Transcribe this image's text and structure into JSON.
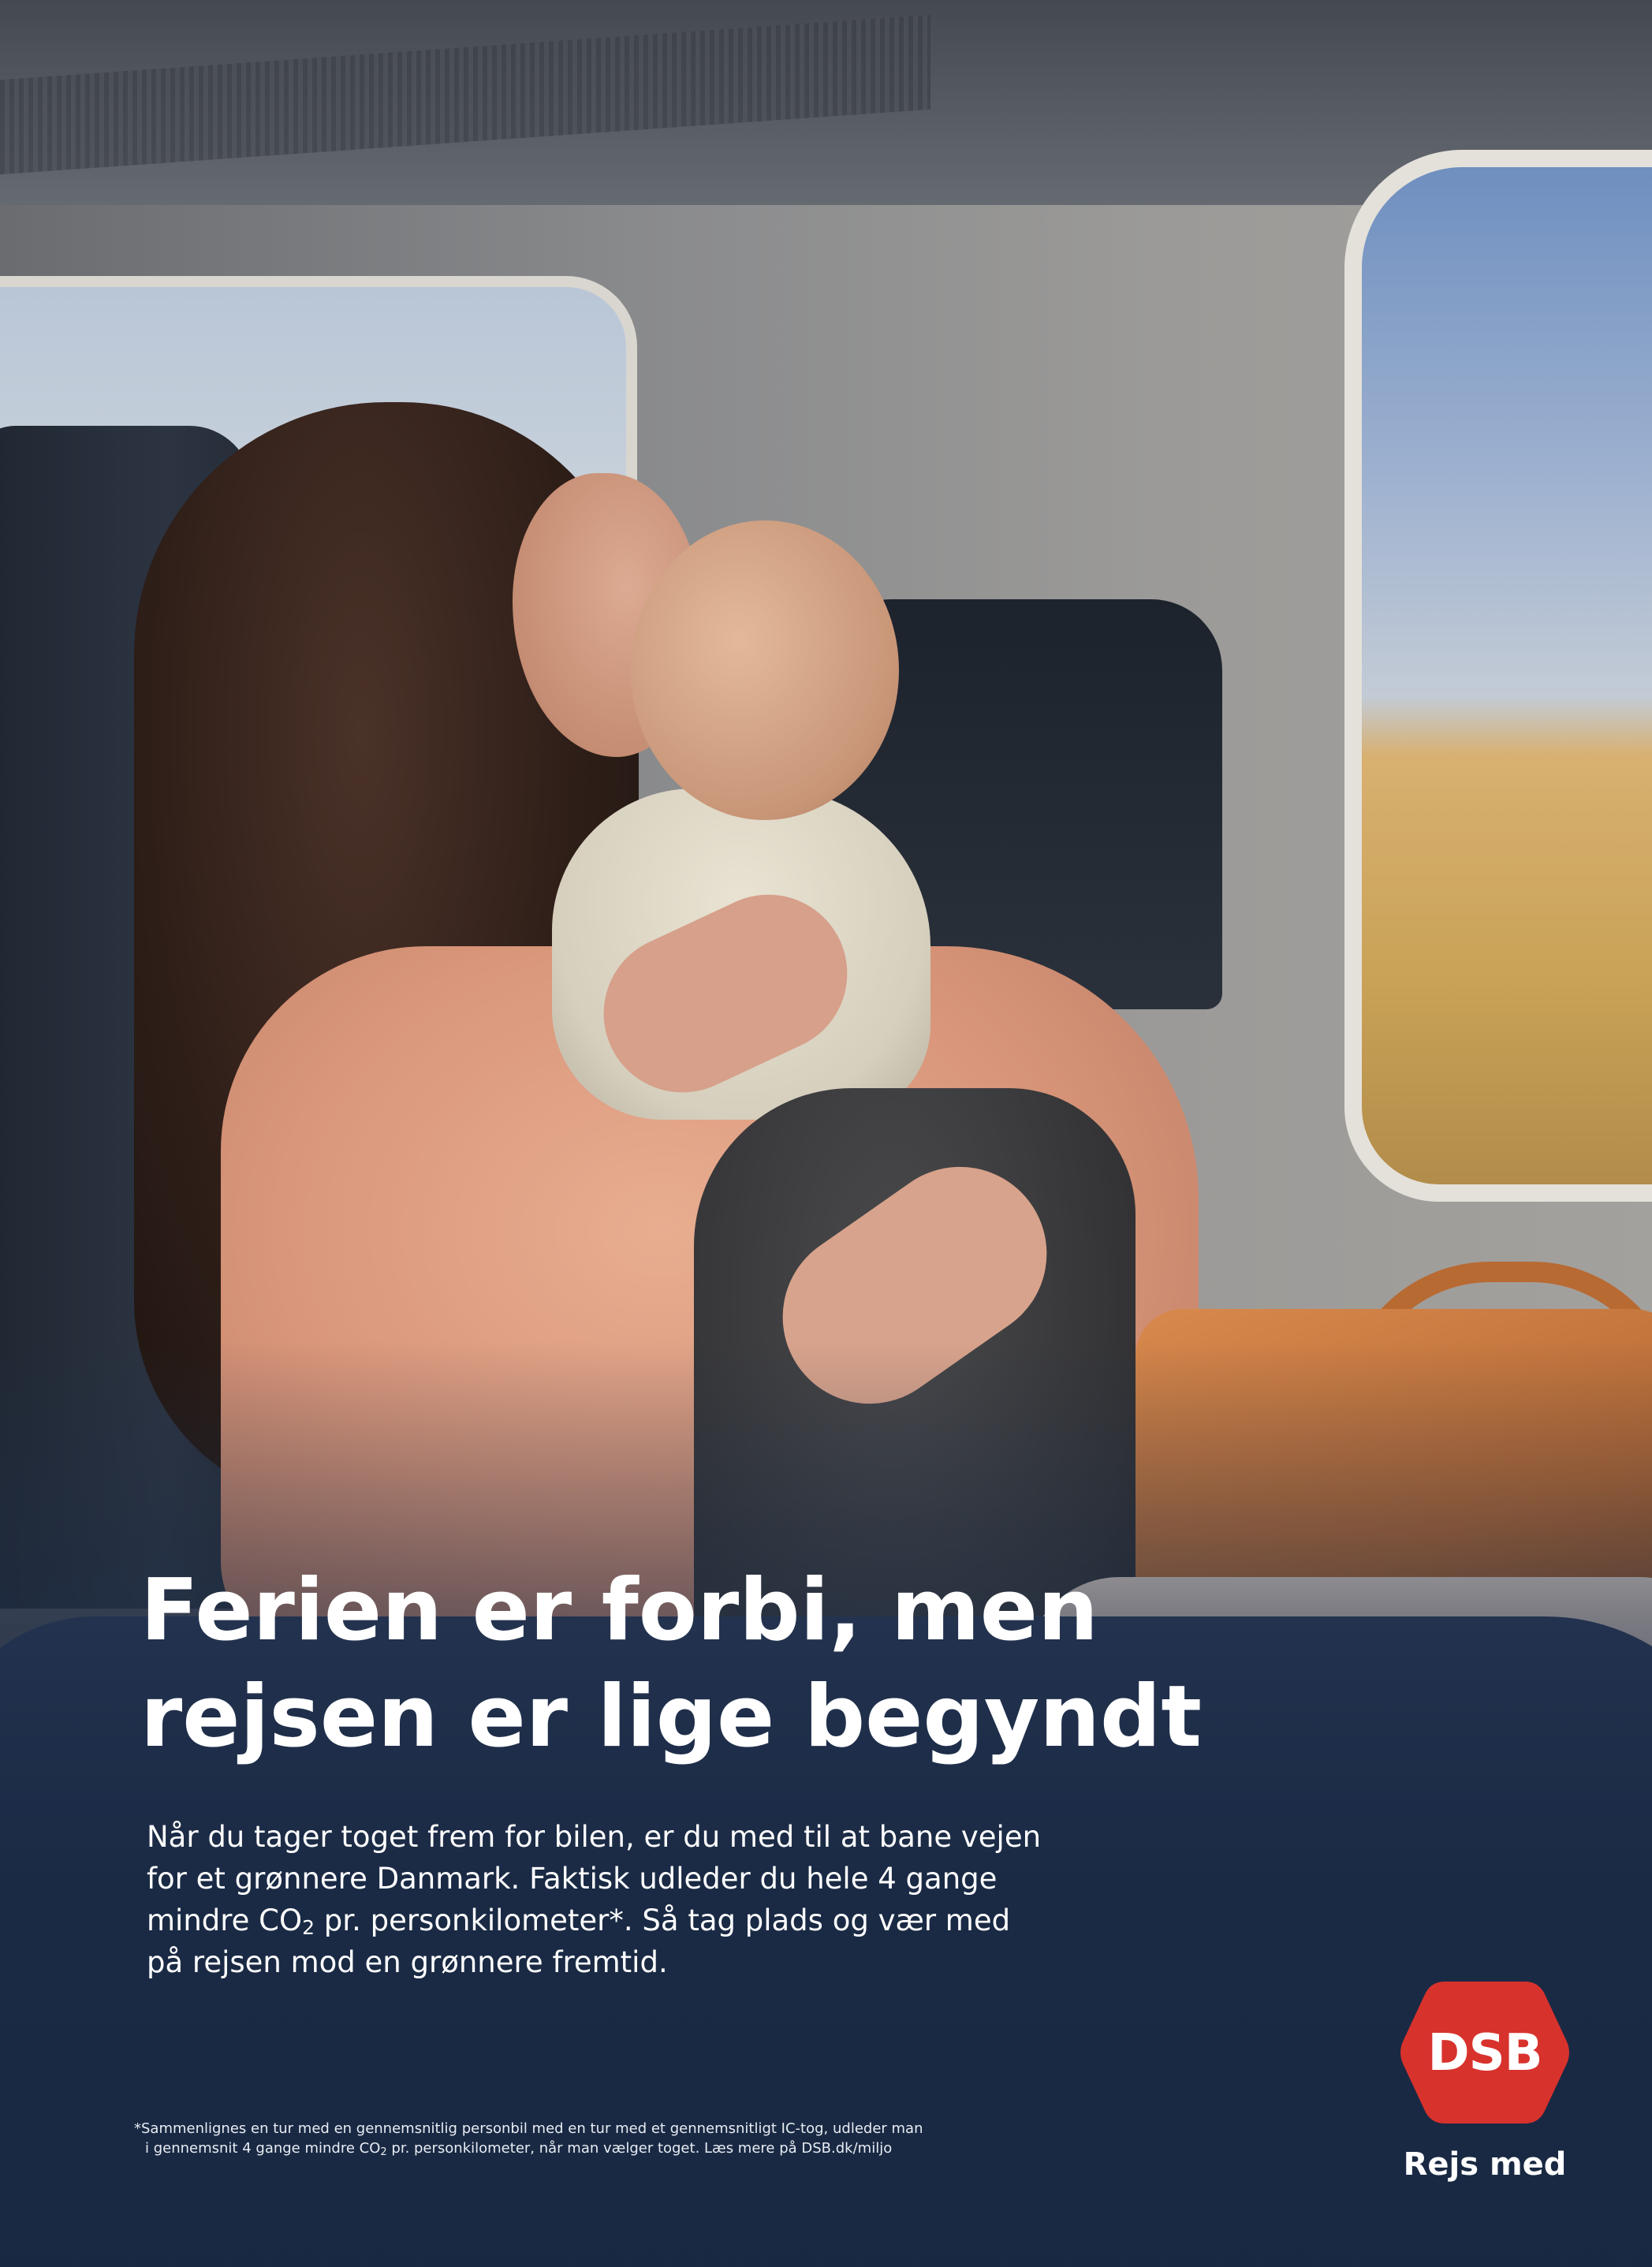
{
  "headline": {
    "line1": "Ferien er forbi, men",
    "line2": "rejsen er lige begyndt"
  },
  "body": {
    "line1": "Når du tager toget frem for bilen, er du med til at bane vejen",
    "line2": "for et grønnere Danmark. Faktisk udleder du hele 4 gange",
    "line3_pre": "mindre CO",
    "line3_sub": "2",
    "line3_post": " pr. personkilometer*. Så tag plads og vær med",
    "line4": "på rejsen mod en grønnere fremtid."
  },
  "footnote": {
    "line1": "*Sammenlignes en tur med en gennemsnitlig personbil med en tur med et gennemsnitligt IC-tog, udleder man",
    "line2_pre": "i gennemsnit 4 gange mindre CO",
    "line2_sub": "2",
    "line2_post": " pr. personkilometer, når man vælger toget. Læs mere på DSB.dk/miljo"
  },
  "brand": {
    "logo_text": "DSB",
    "tagline": "Rejs med",
    "logo_color": "#d8322d"
  },
  "colors": {
    "text": "#ffffff",
    "overlay": "#1c2c46"
  }
}
